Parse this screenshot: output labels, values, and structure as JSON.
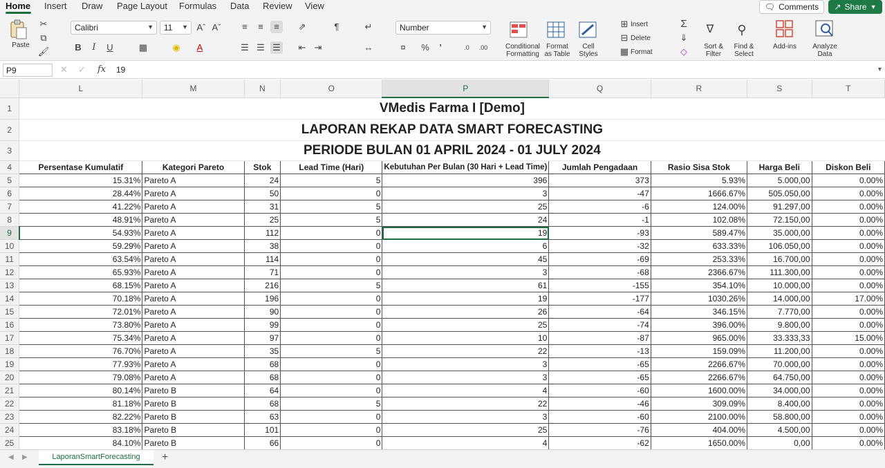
{
  "menu": {
    "tabs": [
      "Home",
      "Insert",
      "Draw",
      "Page Layout",
      "Formulas",
      "Data",
      "Review",
      "View"
    ],
    "comments_label": "Comments",
    "share_label": "Share"
  },
  "ribbon": {
    "paste_label": "Paste",
    "font_name": "Calibri",
    "font_size": "11",
    "number_format": "Number",
    "conditional_formatting": [
      "Conditional",
      "Formatting"
    ],
    "format_as_table": [
      "Format",
      "as Table"
    ],
    "cell_styles": [
      "Cell",
      "Styles"
    ],
    "insert_label": "Insert",
    "delete_label": "Delete",
    "format_label": "Format",
    "sort_filter": [
      "Sort &",
      "Filter"
    ],
    "find_select": [
      "Find &",
      "Select"
    ],
    "addins_label": "Add-ins",
    "analyze_data": [
      "Analyze",
      "Data"
    ]
  },
  "formula_bar": {
    "name_box": "P9",
    "fx": "fx",
    "formula": "19"
  },
  "columns": [
    "L",
    "M",
    "N",
    "O",
    "P",
    "Q",
    "R",
    "S",
    "T"
  ],
  "selected_column": "P",
  "selected_row": 9,
  "titles": [
    "VMedis Farma I [Demo]",
    "LAPORAN REKAP DATA SMART FORECASTING",
    "PERIODE BULAN 01 APRIL 2024 - 01 JULY 2024"
  ],
  "headers": [
    "Persentase Kumulatif",
    "Kategori Pareto",
    "Stok",
    "Lead Time (Hari)",
    "Kebutuhan Per Bulan (30 Hari + Lead Time)",
    "Jumlah Pengadaan",
    "Rasio Sisa Stok",
    "Harga Beli",
    "Diskon Beli"
  ],
  "rows": [
    [
      "15.31%",
      "Pareto A",
      "24",
      "5",
      "396",
      "373",
      "5.93%",
      "5.000,00",
      "0.00%"
    ],
    [
      "28.44%",
      "Pareto A",
      "50",
      "0",
      "3",
      "-47",
      "1666.67%",
      "505.050,00",
      "0.00%"
    ],
    [
      "41.22%",
      "Pareto A",
      "31",
      "5",
      "25",
      "-6",
      "124.00%",
      "91.297,00",
      "0.00%"
    ],
    [
      "48.91%",
      "Pareto A",
      "25",
      "5",
      "24",
      "-1",
      "102.08%",
      "72.150,00",
      "0.00%"
    ],
    [
      "54.93%",
      "Pareto A",
      "112",
      "0",
      "19",
      "-93",
      "589.47%",
      "35.000,00",
      "0.00%"
    ],
    [
      "59.29%",
      "Pareto A",
      "38",
      "0",
      "6",
      "-32",
      "633.33%",
      "106.050,00",
      "0.00%"
    ],
    [
      "63.54%",
      "Pareto A",
      "114",
      "0",
      "45",
      "-69",
      "253.33%",
      "16.700,00",
      "0.00%"
    ],
    [
      "65.93%",
      "Pareto A",
      "71",
      "0",
      "3",
      "-68",
      "2366.67%",
      "111.300,00",
      "0.00%"
    ],
    [
      "68.15%",
      "Pareto A",
      "216",
      "5",
      "61",
      "-155",
      "354.10%",
      "10.000,00",
      "0.00%"
    ],
    [
      "70.18%",
      "Pareto A",
      "196",
      "0",
      "19",
      "-177",
      "1030.26%",
      "14.000,00",
      "17.00%"
    ],
    [
      "72.01%",
      "Pareto A",
      "90",
      "0",
      "26",
      "-64",
      "346.15%",
      "7.770,00",
      "0.00%"
    ],
    [
      "73.80%",
      "Pareto A",
      "99",
      "0",
      "25",
      "-74",
      "396.00%",
      "9.800,00",
      "0.00%"
    ],
    [
      "75.34%",
      "Pareto A",
      "97",
      "0",
      "10",
      "-87",
      "965.00%",
      "33.333,33",
      "15.00%"
    ],
    [
      "76.70%",
      "Pareto A",
      "35",
      "5",
      "22",
      "-13",
      "159.09%",
      "11.200,00",
      "0.00%"
    ],
    [
      "77.93%",
      "Pareto A",
      "68",
      "0",
      "3",
      "-65",
      "2266.67%",
      "70.000,00",
      "0.00%"
    ],
    [
      "79.08%",
      "Pareto A",
      "68",
      "0",
      "3",
      "-65",
      "2266.67%",
      "64.750,00",
      "0.00%"
    ],
    [
      "80.14%",
      "Pareto B",
      "64",
      "0",
      "4",
      "-60",
      "1600.00%",
      "34.000,00",
      "0.00%"
    ],
    [
      "81.18%",
      "Pareto B",
      "68",
      "5",
      "22",
      "-46",
      "309.09%",
      "8.400,00",
      "0.00%"
    ],
    [
      "82.22%",
      "Pareto B",
      "63",
      "0",
      "3",
      "-60",
      "2100.00%",
      "58.800,00",
      "0.00%"
    ],
    [
      "83.18%",
      "Pareto B",
      "101",
      "0",
      "25",
      "-76",
      "404.00%",
      "4.500,00",
      "0.00%"
    ],
    [
      "84.10%",
      "Pareto B",
      "66",
      "0",
      "4",
      "-62",
      "1650.00%",
      "0,00",
      "0.00%"
    ]
  ],
  "sheet_tab": "LaporanSmartForecasting",
  "colors": {
    "accent": "#1d6f42",
    "share": "#1d7a45"
  }
}
